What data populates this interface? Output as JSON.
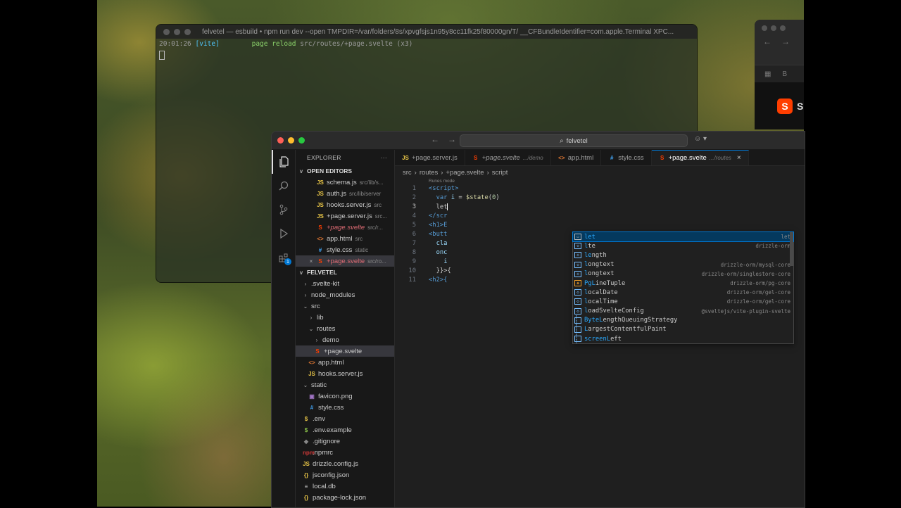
{
  "terminal": {
    "title": "felvetel — esbuild • npm run dev --open TMPDIR=/var/folders/8s/xpvgfsjs1n95y8cc11fk25f80000gn/T/ __CFBundleIdentifier=com.apple.Terminal XPC...",
    "time": "20:01:26",
    "tag": "[vite]",
    "message": "page reload",
    "path": "src/routes/+page.svelte (x3)"
  },
  "browser": {
    "page_initial": "S",
    "bar_text": "B"
  },
  "vscode": {
    "search_label": "felvetel",
    "explorer_title": "EXPLORER",
    "explorer_more": "···",
    "open_editors_label": "OPEN EDITORS",
    "project_label": "FELVETEL",
    "activity_badge": "1",
    "open_editors": [
      {
        "icon": "JS",
        "name": "schema.js",
        "desc": "src/lib/s...",
        "kind": "js"
      },
      {
        "icon": "JS",
        "name": "auth.js",
        "desc": "src/lib/server",
        "kind": "js"
      },
      {
        "icon": "JS",
        "name": "hooks.server.js",
        "desc": "src",
        "kind": "js"
      },
      {
        "icon": "JS",
        "name": "+page.server.js",
        "desc": "src...",
        "kind": "js"
      },
      {
        "icon": "S",
        "name": "+page.svelte",
        "desc": "src/r...",
        "kind": "svelte",
        "italic": true
      },
      {
        "icon": "<>",
        "name": "app.html",
        "desc": "src",
        "kind": "html"
      },
      {
        "icon": "#",
        "name": "style.css",
        "desc": "static",
        "kind": "css"
      },
      {
        "icon": "S",
        "name": "+page.svelte",
        "desc": "src/ro...",
        "kind": "svelte",
        "active": true
      }
    ],
    "tree": [
      {
        "chev": ">",
        "icon": "",
        "name": ".svelte-kit",
        "depth": 0
      },
      {
        "chev": ">",
        "icon": "",
        "name": "node_modules",
        "depth": 0
      },
      {
        "chev": "v",
        "icon": "",
        "name": "src",
        "depth": 0
      },
      {
        "chev": ">",
        "icon": "",
        "name": "lib",
        "depth": 1
      },
      {
        "chev": "v",
        "icon": "",
        "name": "routes",
        "depth": 1
      },
      {
        "chev": ">",
        "icon": "",
        "name": "demo",
        "depth": 2
      },
      {
        "chev": "",
        "icon": "S",
        "name": "+page.svelte",
        "depth": 2,
        "kind": "svelte",
        "selected": true
      },
      {
        "chev": "",
        "icon": "<>",
        "name": "app.html",
        "depth": 1,
        "kind": "html"
      },
      {
        "chev": "",
        "icon": "JS",
        "name": "hooks.server.js",
        "depth": 1,
        "kind": "js"
      },
      {
        "chev": "v",
        "icon": "",
        "name": "static",
        "depth": 0
      },
      {
        "chev": "",
        "icon": "▣",
        "name": "favicon.png",
        "depth": 1,
        "kind": "img"
      },
      {
        "chev": "",
        "icon": "#",
        "name": "style.css",
        "depth": 1,
        "kind": "css"
      },
      {
        "chev": "",
        "icon": "$",
        "name": ".env",
        "depth": 0,
        "kind": "env"
      },
      {
        "chev": "",
        "icon": "$",
        "name": ".env.example",
        "depth": 0,
        "kind": "dollar"
      },
      {
        "chev": "",
        "icon": "◆",
        "name": ".gitignore",
        "depth": 0,
        "kind": "git"
      },
      {
        "chev": "",
        "icon": "npm",
        "name": ".npmrc",
        "depth": 0,
        "kind": "npm"
      },
      {
        "chev": "",
        "icon": "JS",
        "name": "drizzle.config.js",
        "depth": 0,
        "kind": "js"
      },
      {
        "chev": "",
        "icon": "{}",
        "name": "jsconfig.json",
        "depth": 0,
        "kind": "json"
      },
      {
        "chev": "",
        "icon": "≡",
        "name": "local.db",
        "depth": 0,
        "kind": "db"
      },
      {
        "chev": "",
        "icon": "{}",
        "name": "package-lock.json",
        "depth": 0,
        "kind": "json"
      }
    ],
    "tabs": [
      {
        "icon": "JS",
        "name": "+page.server.js",
        "desc": "",
        "kind": "js"
      },
      {
        "icon": "S",
        "name": "+page.svelte",
        "desc": ".../demo",
        "kind": "svelte",
        "italic": true
      },
      {
        "icon": "<>",
        "name": "app.html",
        "desc": "",
        "kind": "html"
      },
      {
        "icon": "#",
        "name": "style.css",
        "desc": "",
        "kind": "css"
      },
      {
        "icon": "S",
        "name": "+page.svelte",
        "desc": ".../routes",
        "kind": "svelte",
        "active": true
      }
    ],
    "breadcrumbs": [
      "src",
      ">",
      "routes",
      ">",
      "+page.svelte",
      ">",
      "script"
    ],
    "codelens": "Runes mode",
    "line_numbers": [
      "1",
      "2",
      "3",
      "4",
      "5",
      "6",
      "7",
      "8",
      "9",
      "10",
      "11"
    ],
    "code": {
      "l1": "<script>",
      "l2_kw": "var",
      "l2_var": "i",
      "l2_eq": " = ",
      "l2_fn": "$state",
      "l2_open": "(",
      "l2_num": "0",
      "l2_close": ")",
      "l3": "let",
      "l4": "</scr",
      "l5": "<h1>E",
      "l6": "<butt",
      "l7": "cla",
      "l8": "onc",
      "l9": "i",
      "l10": "}}>{",
      "l11": "<h2>{"
    },
    "suggestions": [
      {
        "icon": "kw",
        "label": "let",
        "match": "let",
        "rest": "",
        "detail": "let",
        "selected": true
      },
      {
        "icon": "fn",
        "label": "lte",
        "match": "l",
        "rest": "te",
        "detail": "drizzle-orm"
      },
      {
        "icon": "fn",
        "label": "length",
        "match": "le",
        "rest": "ngth",
        "detail": ""
      },
      {
        "icon": "fn",
        "label": "longtext",
        "match": "l",
        "rest": "ongtext",
        "detail": "drizzle-orm/mysql-core"
      },
      {
        "icon": "fn",
        "label": "longtext",
        "match": "l",
        "rest": "ongtext",
        "detail": "drizzle-orm/singlestore-core"
      },
      {
        "icon": "cls",
        "label": "PgLineTuple",
        "match": "PgL",
        "rest": "ineTuple",
        "detail": "drizzle-orm/pg-core"
      },
      {
        "icon": "fn",
        "label": "localDate",
        "match": "l",
        "rest": "ocalDate",
        "detail": "drizzle-orm/gel-core"
      },
      {
        "icon": "fn",
        "label": "localTime",
        "match": "l",
        "rest": "ocalTime",
        "detail": "drizzle-orm/gel-core"
      },
      {
        "icon": "fn",
        "label": "loadSvelteConfig",
        "match": "l",
        "rest": "oadSvelteConfig",
        "detail": "@sveltejs/vite-plugin-svelte"
      },
      {
        "icon": "var",
        "label": "ByteLengthQueuingStrategy",
        "match": "ByteL",
        "rest": "engthQueuingStrategy",
        "detail": ""
      },
      {
        "icon": "var",
        "label": "LargestContentfulPaint",
        "match": "L",
        "rest": "argestContentfulPaint",
        "detail": ""
      },
      {
        "icon": "var",
        "label": "screenLeft",
        "match": "screenL",
        "rest": "eft",
        "detail": ""
      }
    ]
  }
}
